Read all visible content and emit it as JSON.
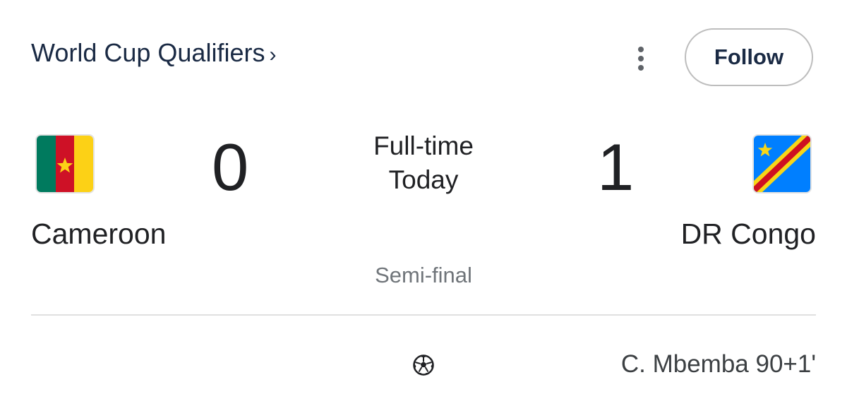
{
  "header": {
    "competition": "World Cup Qualifiers",
    "competition_chevron": "›",
    "more_icon": "more-vert-icon",
    "follow_label": "Follow"
  },
  "match": {
    "home": {
      "name": "Cameroon",
      "score": "0",
      "flag_icon": "cameroon-flag-icon",
      "flag_colors": [
        "#007a5e",
        "#ce1126",
        "#fcd116"
      ]
    },
    "away": {
      "name": "DR Congo",
      "score": "1",
      "flag_icon": "dr-congo-flag-icon",
      "flag_colors": [
        "#007fff",
        "#f7d618",
        "#ce1021"
      ]
    },
    "status": "Full-time",
    "date": "Today",
    "round": "Semi-final"
  },
  "events": [
    {
      "icon": "soccer-ball-icon",
      "text": "C. Mbemba 90+1'"
    }
  ]
}
